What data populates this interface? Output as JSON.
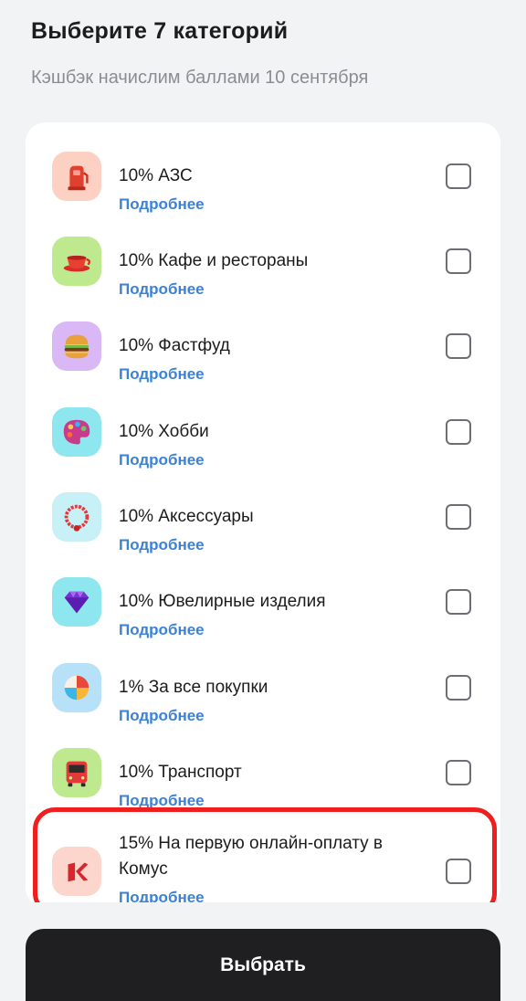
{
  "header": {
    "title": "Выберите 7 категорий",
    "subtitle": "Кэшбэк начислим баллами 10 сентября"
  },
  "categories": [
    {
      "label": "10% АЗС",
      "link": "Подробнее",
      "icon": "gas-station-icon",
      "icon_bg": "#fcd0c2",
      "checked": false
    },
    {
      "label": "10% Кафе и рестораны",
      "link": "Подробнее",
      "icon": "teacup-icon",
      "icon_bg": "#bfe98f",
      "checked": false
    },
    {
      "label": "10% Фастфуд",
      "link": "Подробнее",
      "icon": "burger-icon",
      "icon_bg": "#d9b8f5",
      "checked": false
    },
    {
      "label": "10% Хобби",
      "link": "Подробнее",
      "icon": "palette-icon",
      "icon_bg": "#8ee6ef",
      "checked": false
    },
    {
      "label": "10% Аксессуары",
      "link": "Подробнее",
      "icon": "bead-necklace-icon",
      "icon_bg": "#c7f0f7",
      "checked": false
    },
    {
      "label": "10% Ювелирные изделия",
      "link": "Подробнее",
      "icon": "gem-icon",
      "icon_bg": "#8ee6ef",
      "checked": false
    },
    {
      "label": "1% За все покупки",
      "link": "Подробнее",
      "icon": "pie-chart-icon",
      "icon_bg": "#b6e1f8",
      "checked": false
    },
    {
      "label": "10% Транспорт",
      "link": "Подробнее",
      "icon": "bus-icon",
      "icon_bg": "#bfe98f",
      "checked": false
    },
    {
      "label": "15% На первую онлайн-оплату в Комус",
      "link": "Подробнее",
      "icon": "komus-logo-icon",
      "icon_bg": "#fcd6cc",
      "checked": false
    }
  ],
  "select_button": {
    "label": "Выбрать"
  },
  "colors": {
    "accent_link": "#3b82d6",
    "highlight": "#ef1f1f",
    "button": "#1f1f21"
  }
}
